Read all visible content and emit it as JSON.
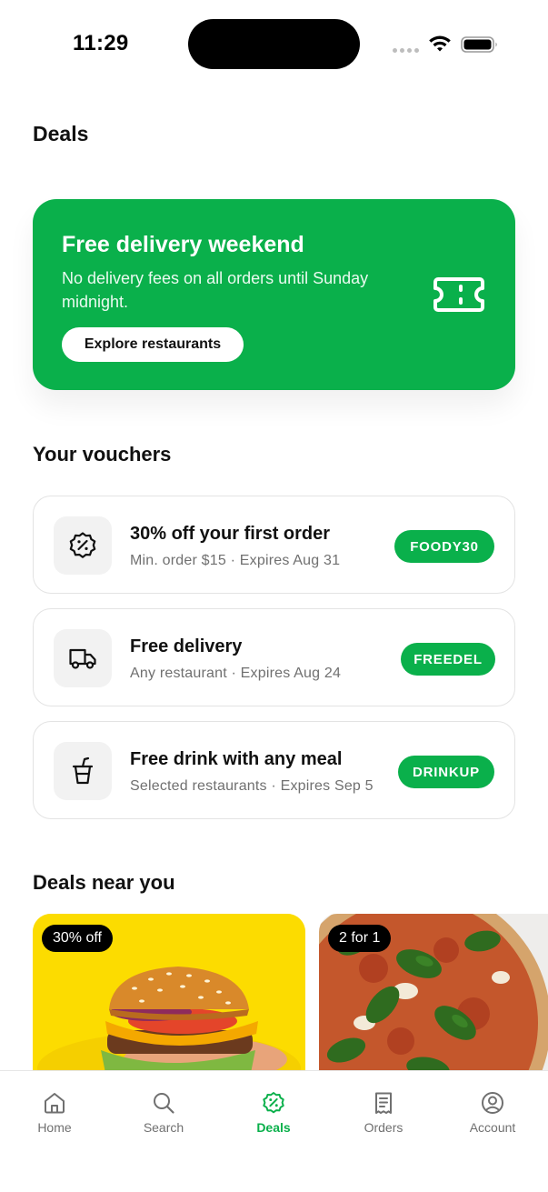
{
  "status_bar": {
    "time": "11:29"
  },
  "page": {
    "title": "Deals"
  },
  "promo": {
    "title": "Free delivery weekend",
    "description": "No delivery fees on all orders until Sunday midnight.",
    "button_label": "Explore restaurants",
    "icon": "ticket-icon"
  },
  "vouchers": {
    "title": "Your vouchers",
    "items": [
      {
        "title": "30% off your first order",
        "subtitle": "Min. order $15 · Expires Aug 31",
        "code": "FOODY30",
        "icon": "percent-badge-icon"
      },
      {
        "title": "Free delivery",
        "subtitle": "Any restaurant · Expires Aug 24",
        "code": "FREEDEL",
        "icon": "truck-icon"
      },
      {
        "title": "Free drink with any meal",
        "subtitle": "Selected restaurants · Expires Sep 5",
        "code": "DRINKUP",
        "icon": "cup-icon"
      }
    ]
  },
  "deals_near": {
    "title": "Deals near you",
    "items": [
      {
        "badge": "30% off",
        "image": "burger-photo"
      },
      {
        "badge": "2 for 1",
        "image": "pizza-photo"
      }
    ]
  },
  "tabs": [
    {
      "label": "Home",
      "icon": "home-icon",
      "active": false
    },
    {
      "label": "Search",
      "icon": "search-icon",
      "active": false
    },
    {
      "label": "Deals",
      "icon": "percent-badge-icon",
      "active": true
    },
    {
      "label": "Orders",
      "icon": "receipt-icon",
      "active": false
    },
    {
      "label": "Account",
      "icon": "user-circle-icon",
      "active": false
    }
  ],
  "colors": {
    "accent": "#0ab04b",
    "text": "#111111",
    "muted": "#707070",
    "border": "#e3e3e3"
  }
}
